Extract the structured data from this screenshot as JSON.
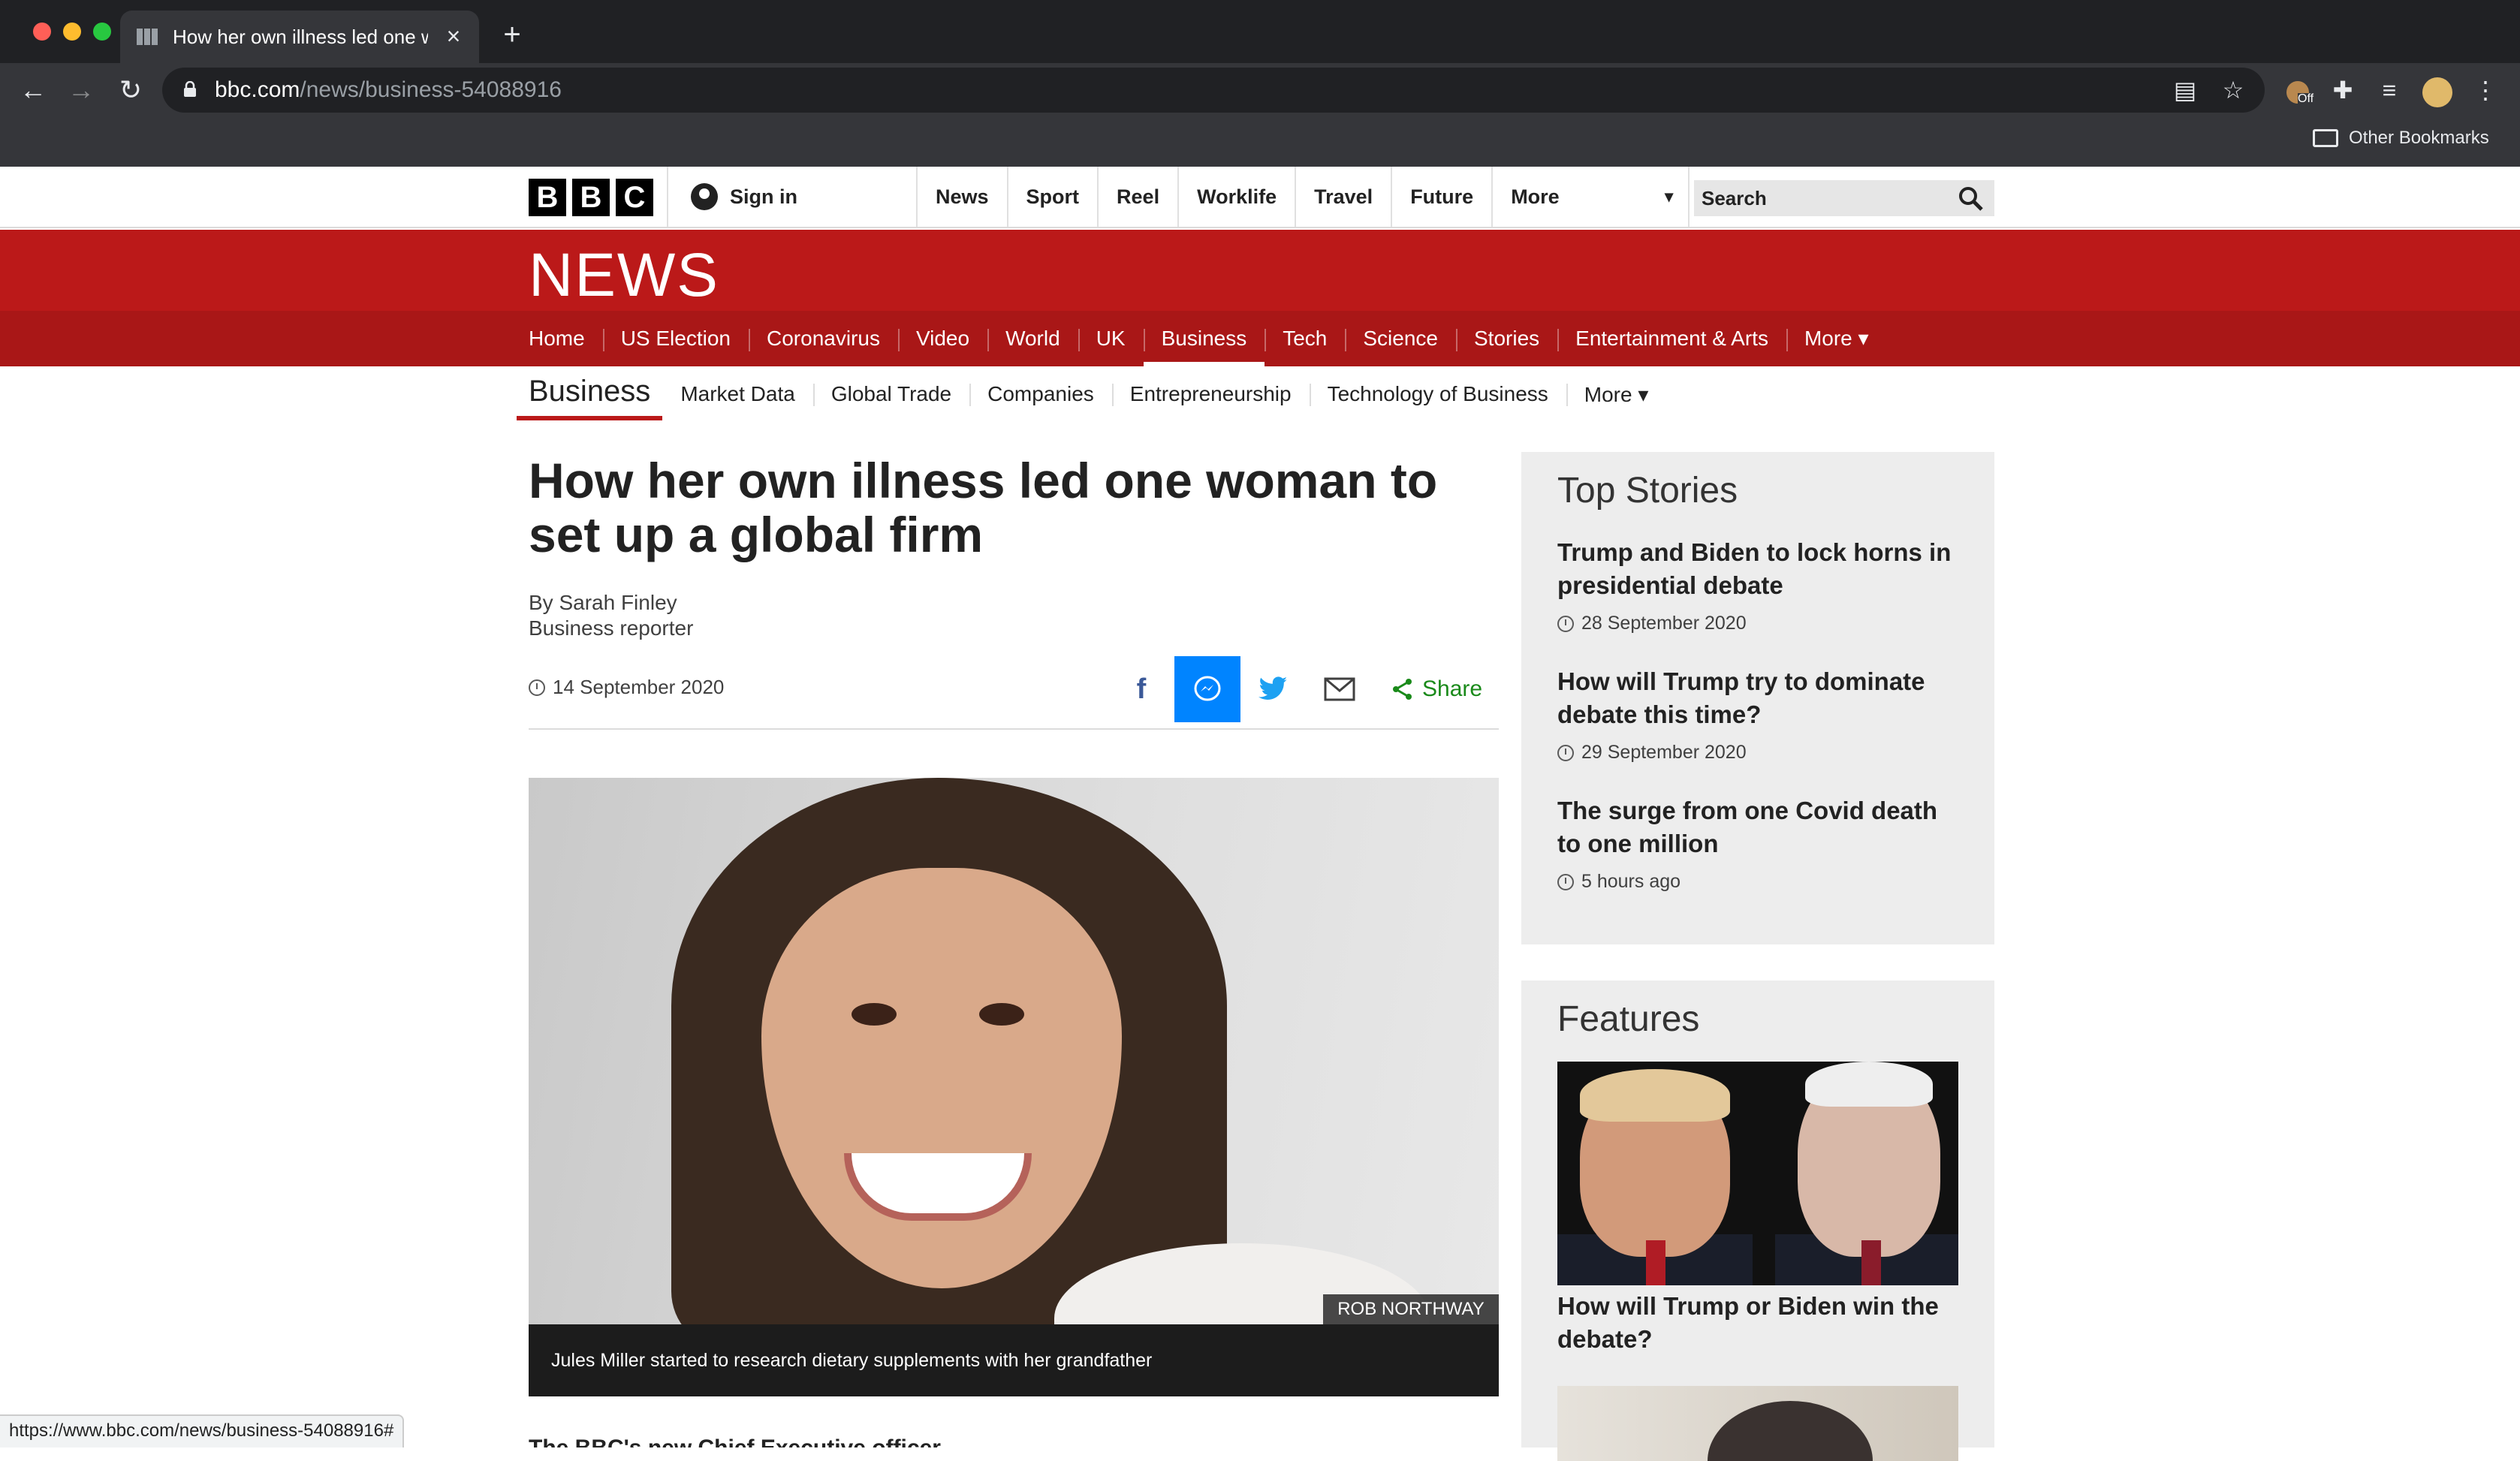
{
  "browser": {
    "tab_title": "How her own illness led one woman to set up a global firm",
    "url_domain": "bbc.com",
    "url_path": "/news/business-54088916",
    "bookmarks_label": "Other Bookmarks",
    "extension_badge": "Off",
    "status_url": "https://www.bbc.com/news/business-54088916#"
  },
  "bbc": {
    "logo_letters": [
      "B",
      "B",
      "C"
    ],
    "sign_in": "Sign in",
    "top_nav": [
      "News",
      "Sport",
      "Reel",
      "Worklife",
      "Travel",
      "Future",
      "More"
    ],
    "more_caret": "▾",
    "search_placeholder": "Search",
    "news_logo": "NEWS",
    "section_nav": [
      "Home",
      "US Election",
      "Coronavirus",
      "Video",
      "World",
      "UK",
      "Business",
      "Tech",
      "Science",
      "Stories",
      "Entertainment & Arts",
      "More ▾"
    ],
    "active_section": "Business"
  },
  "subnav": {
    "brand": "Business",
    "items": [
      "Market Data",
      "Global Trade",
      "Companies",
      "Entrepreneurship",
      "Technology of Business",
      "More ▾"
    ]
  },
  "article": {
    "headline": "How her own illness led one woman to set up a global firm",
    "author": "By Sarah Finley",
    "role": "Business reporter",
    "date": "14 September 2020",
    "share_label": "Share",
    "image_credit": "ROB NORTHWAY",
    "image_caption": "Jules Miller started to research dietary supplements with her grandfather",
    "first_line": "The BBC's new Chief Executive officer..."
  },
  "top_stories": {
    "heading": "Top Stories",
    "items": [
      {
        "title": "Trump and Biden to lock horns in presidential debate",
        "date": "28 September 2020"
      },
      {
        "title": "How will Trump try to dominate debate this time?",
        "date": "29 September 2020"
      },
      {
        "title": "The surge from one Covid death to one million",
        "date": "5 hours ago"
      }
    ]
  },
  "features": {
    "heading": "Features",
    "items": [
      {
        "title": "How will Trump or Biden win the debate?"
      }
    ]
  },
  "colors": {
    "bbc_red": "#bb1919",
    "bbc_red_dark": "#a91717",
    "messenger_blue": "#0084ff",
    "share_green": "#1a8a1a"
  }
}
